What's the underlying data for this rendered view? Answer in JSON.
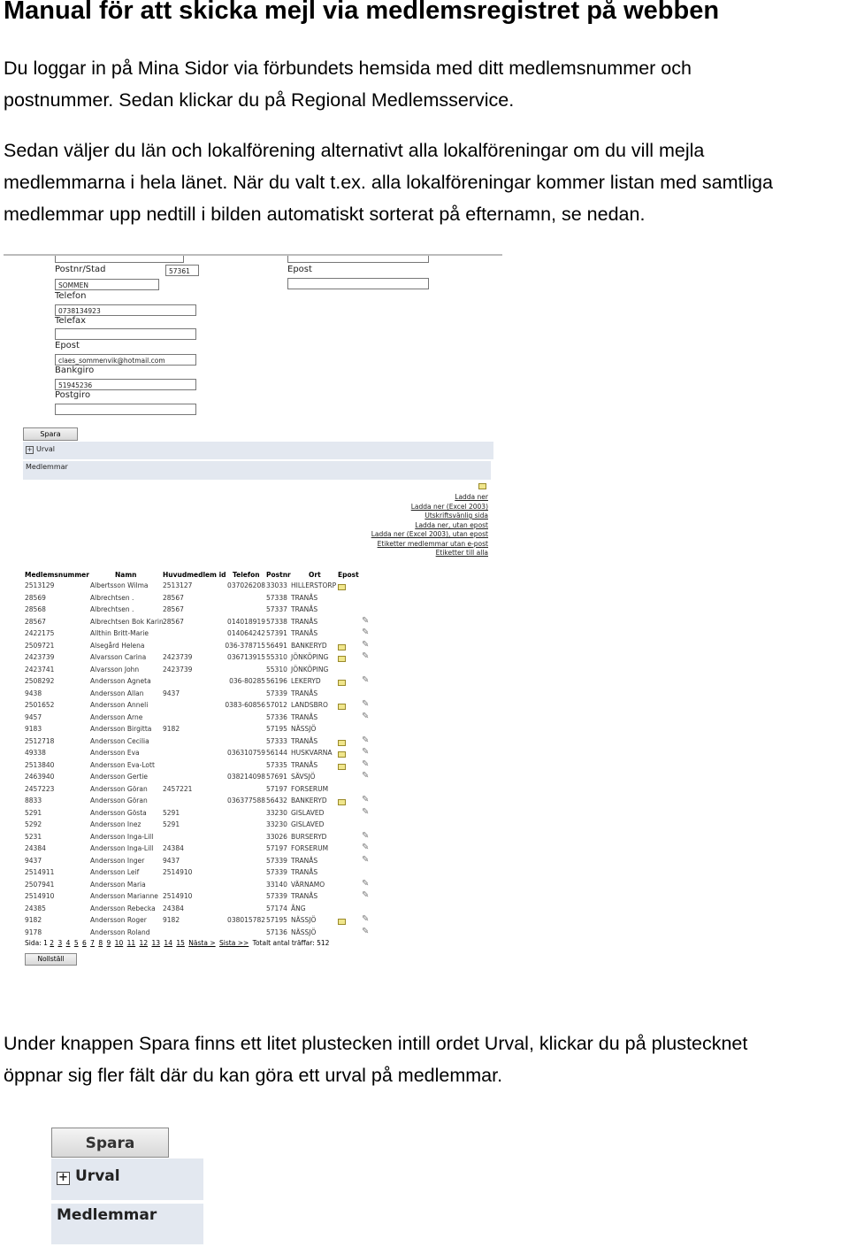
{
  "title": "Manual för att skicka mejl via medlemsregistret på webben",
  "paragraphs": [
    [
      "Du loggar in på Mina Sidor via förbundets hemsida med ditt medlemsnummer och",
      "postnummer. Sedan klickar du på Regional Medlemsservice."
    ],
    [
      "Sedan väljer du län och lokalförening alternativt alla lokalföreningar om du vill mejla",
      "medlemmarna i hela länet. När du valt t.ex. alla lokalföreningar kommer listan med samtliga",
      "medlemmar upp nedtill i bilden automatiskt sorterat på efternamn, se nedan."
    ],
    [
      "Under knappen Spara finns ett litet plustecken intill ordet Urval, klickar du på plustecknet",
      "öppnar sig fler fält där du kan göra ett urval på medlemmar."
    ]
  ],
  "screenshot": {
    "form": {
      "postnr_label": "Postnr/Stad",
      "postnr": "57361",
      "stad": "SOMMEN",
      "telefon_label": "Telefon",
      "telefon": "0738134923",
      "telefax_label": "Telefax",
      "telefax": "",
      "epost_label": "Epost",
      "epost": "claes_sommenvik@hotmail.com",
      "bankgiro_label": "Bankgiro",
      "bankgiro": "51945236",
      "postgiro_label": "Postgiro",
      "postgiro": "",
      "right_epost_label": "Epost",
      "right_epost": ""
    },
    "save_button": "Spara",
    "urval_label": "Urval",
    "medlemmar_label": "Medlemmar",
    "links": [
      "Ladda ner",
      "Ladda ner (Excel 2003)",
      "Utskriftsvänlig sida",
      "Ladda ner, utan epost",
      "Ladda ner (Excel 2003), utan epost",
      "Etiketter medlemmar utan e-post",
      "Etiketter till alla"
    ],
    "columns": [
      "Medlemsnummer",
      "Namn",
      "Huvudmedlem id",
      "Telefon",
      "Postnr",
      "Ort",
      "Epost"
    ],
    "rows": [
      [
        "2513129",
        "Albertsson Wilma",
        "2513127",
        "037026208",
        "33033",
        "HILLERSTORP",
        true,
        false
      ],
      [
        "28569",
        "Albrechtsen .",
        "28567",
        "",
        "57338",
        "TRANÅS",
        false,
        false
      ],
      [
        "28568",
        "Albrechtsen .",
        "28567",
        "",
        "57337",
        "TRANÅS",
        false,
        false
      ],
      [
        "28567",
        "Albrechtsen Bok Karin",
        "28567",
        "014018919",
        "57338",
        "TRANÅS",
        false,
        true
      ],
      [
        "2422175",
        "Allthin Britt-Marie",
        "",
        "014064242",
        "57391",
        "TRANÅS",
        false,
        true
      ],
      [
        "2509721",
        "Alsegård Helena",
        "",
        "036-378715",
        "56491",
        "BANKERYD",
        true,
        true
      ],
      [
        "2423739",
        "Alvarsson Carina",
        "2423739",
        "036713915",
        "55310",
        "JÖNKÖPING",
        true,
        true
      ],
      [
        "2423741",
        "Alvarsson John",
        "2423739",
        "",
        "55310",
        "JÖNKÖPING",
        false,
        false
      ],
      [
        "2508292",
        "Andersson Agneta",
        "",
        "036-80285",
        "56196",
        "LEKERYD",
        true,
        true
      ],
      [
        "9438",
        "Andersson Allan",
        "9437",
        "",
        "57339",
        "TRANÅS",
        false,
        false
      ],
      [
        "2501652",
        "Andersson Anneli",
        "",
        "0383-60856",
        "57012",
        "LANDSBRO",
        true,
        true
      ],
      [
        "9457",
        "Andersson Arne",
        "",
        "",
        "57336",
        "TRANÅS",
        false,
        true
      ],
      [
        "9183",
        "Andersson Birgitta",
        "9182",
        "",
        "57195",
        "NÄSSJÖ",
        false,
        false
      ],
      [
        "2512718",
        "Andersson Cecilia",
        "",
        "",
        "57333",
        "TRANÅS",
        true,
        true
      ],
      [
        "49338",
        "Andersson Eva",
        "",
        "036310759",
        "56144",
        "HUSKVARNA",
        true,
        true
      ],
      [
        "2513840",
        "Andersson Eva-Lott",
        "",
        "",
        "57335",
        "TRANÅS",
        true,
        true
      ],
      [
        "2463940",
        "Andersson Gertie",
        "",
        "038214098",
        "57691",
        "SÄVSJÖ",
        false,
        true
      ],
      [
        "2457223",
        "Andersson Göran",
        "2457221",
        "",
        "57197",
        "FORSERUM",
        false,
        false
      ],
      [
        "8833",
        "Andersson Göran",
        "",
        "036377588",
        "56432",
        "BANKERYD",
        true,
        true
      ],
      [
        "5291",
        "Andersson Gösta",
        "5291",
        "",
        "33230",
        "GISLAVED",
        false,
        true
      ],
      [
        "5292",
        "Andersson Inez",
        "5291",
        "",
        "33230",
        "GISLAVED",
        false,
        false
      ],
      [
        "5231",
        "Andersson Inga-Lill",
        "",
        "",
        "33026",
        "BURSERYD",
        false,
        true
      ],
      [
        "24384",
        "Andersson Inga-Lill",
        "24384",
        "",
        "57197",
        "FORSERUM",
        false,
        true
      ],
      [
        "9437",
        "Andersson Inger",
        "9437",
        "",
        "57339",
        "TRANÅS",
        false,
        true
      ],
      [
        "2514911",
        "Andersson Leif",
        "2514910",
        "",
        "57339",
        "TRANÅS",
        false,
        false
      ],
      [
        "2507941",
        "Andersson Maria",
        "",
        "",
        "33140",
        "VÄRNAMO",
        false,
        true
      ],
      [
        "2514910",
        "Andersson Marianne",
        "2514910",
        "",
        "57339",
        "TRANÅS",
        false,
        true
      ],
      [
        "24385",
        "Andersson Rebecka",
        "24384",
        "",
        "57174",
        "ÅNG",
        false,
        false
      ],
      [
        "9182",
        "Andersson Roger",
        "9182",
        "038015782",
        "57195",
        "NÄSSJÖ",
        true,
        true
      ],
      [
        "9178",
        "Andersson Roland",
        "",
        "",
        "57136",
        "NÄSSJÖ",
        false,
        true
      ]
    ],
    "pager": {
      "label": "Sida:",
      "current": "1",
      "pages": [
        "2",
        "3",
        "4",
        "5",
        "6",
        "7",
        "8",
        "9",
        "10",
        "11",
        "12",
        "13",
        "14",
        "15"
      ],
      "next": "Nästa >",
      "last": "Sista >>",
      "total": "Totalt antal träffar: 512"
    },
    "reset_button": "Nollställ"
  },
  "zoomed": {
    "save_button": "Spara",
    "urval_label": "Urval",
    "medlemmar_label": "Medlemmar"
  },
  "icons": {
    "mail": "envelope-icon",
    "edit": "edit-pencil-icon",
    "expand": "plus-box-icon"
  },
  "colors": {
    "band": "#e3e8f0",
    "mail": "#f0e68c"
  }
}
